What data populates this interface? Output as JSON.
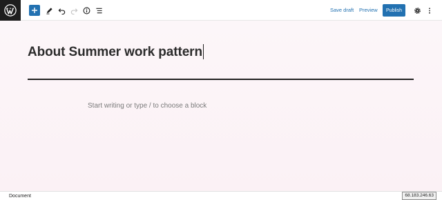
{
  "toolbar": {
    "add_block_icon": "plus-icon",
    "tools_icon": "pencil-icon",
    "undo_icon": "undo-icon",
    "redo_icon": "redo-icon",
    "details_icon": "info-icon",
    "outline_icon": "list-view-icon",
    "save_draft_label": "Save draft",
    "preview_label": "Preview",
    "publish_label": "Publish",
    "settings_icon": "gear-icon",
    "more_icon": "kebab-menu-icon",
    "accent_color": "#2271b1"
  },
  "editor": {
    "title": "About Summer work pattern",
    "placeholder": "Start writing or type / to choose a block"
  },
  "footer": {
    "breadcrumb_label": "Document",
    "ip_address": "68.183.246.63"
  }
}
